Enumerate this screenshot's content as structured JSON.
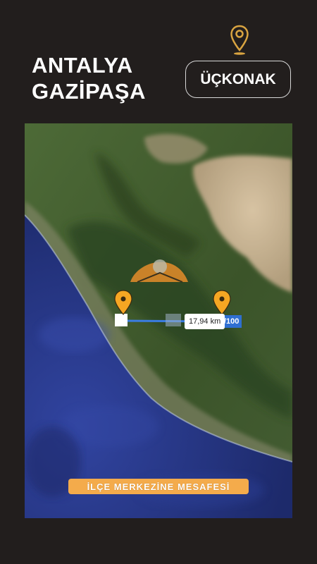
{
  "header": {
    "province": "ANTALYA",
    "district": "GAZİPAŞA",
    "village_button_label": "ÜÇKONAK"
  },
  "map": {
    "distance_label": "17,94 km",
    "scale_label": "/100",
    "caption": "İLÇE MERKEZİNE MESAFESİ",
    "markers": [
      "district-center-pin",
      "village-pin"
    ],
    "colors": {
      "pin": "#f5a623",
      "route": "#3b82f6",
      "caption_bg": "#f4ab4b",
      "sea": "#24337f",
      "land": "#3f5a2c",
      "background": "#221e1d"
    }
  },
  "icons": {
    "top_pin": "location-pin-icon"
  }
}
